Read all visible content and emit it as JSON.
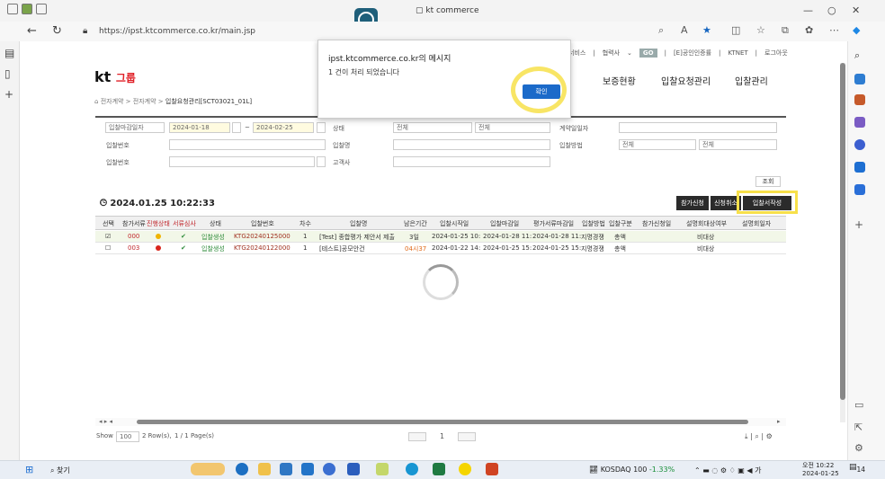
{
  "browser": {
    "tab_title": "kt commerce",
    "url": "https://ipst.ktcommerce.co.kr/main.jsp"
  },
  "page": {
    "top_menu": [
      "서비스",
      "협력사",
      "GO",
      "[E]공인인증률",
      "KTNET",
      "로그아웃"
    ],
    "logo_text": "kt",
    "logo_sub": "그룹",
    "main_nav": [
      "보증현황",
      "입찰요청관리",
      "입찰관리"
    ],
    "breadcrumb": [
      "전자계약",
      "전자계약"
    ],
    "breadcrumb_current": "입찰요청관리[SCT03021_01L]"
  },
  "form": {
    "date_type": "입찰마감일자",
    "date_from": "2024-01-18",
    "date_to": "2024-02-25",
    "status_label": "상태",
    "status_value": "전체",
    "status_value2": "전체",
    "contract_date_label": "계약일일자",
    "request_no_label": "입찰번호",
    "bid_name_label": "입찰명",
    "bid_method_label": "입찰방법",
    "bid_method_value": "전체",
    "bid_method_value2": "전체",
    "bid_no_label": "입찰번호",
    "notice_label": "고객사",
    "search_button": "조회"
  },
  "list": {
    "datetime": "2024.01.25  10:22:33",
    "buttons": [
      "참가신청",
      "신청취소",
      "입찰서작성"
    ],
    "columns": [
      "선택",
      "참가서류",
      "진행상태",
      "서류심사",
      "상태",
      "입찰번호",
      "차수",
      "입찰명",
      "남은기간",
      "입찰시작일",
      "입찰마감일",
      "평가서류마감일",
      "입찰방법",
      "입찰구분",
      "참가신청일",
      "설명회대상여부",
      "설명회일자"
    ],
    "rows": [
      {
        "sel": "☑",
        "doc": "000",
        "prog": "yellow",
        "review": "✔",
        "status": "입찰생성",
        "bid_no": "KTG20240125000",
        "round": "1",
        "name": "[Test] 종합평가 제안서 제출",
        "remain": "3일",
        "start": "2024-01-25 10:",
        "end": "2024-01-28 11:",
        "eval_end": "2024-01-28 11:",
        "method": "지명경쟁",
        "kind": "총액",
        "apply": "",
        "briefing": "비대상"
      },
      {
        "sel": "☐",
        "doc": "003",
        "prog": "red",
        "review": "✔",
        "status": "입찰생성",
        "bid_no": "KTG20240122000",
        "round": "1",
        "name": "[테스트]공모안건",
        "remain": "04시37",
        "start": "2024-01-22 14:",
        "end": "2024-01-25 15:",
        "eval_end": "2024-01-25 15:",
        "method": "지명경쟁",
        "kind": "총액",
        "apply": "",
        "briefing": "비대상"
      }
    ],
    "footer_show": "Show",
    "page_size": "100",
    "rows_info": "2 Row(s),",
    "pages_info": "1 / 1 Page(s)",
    "page_current": "1"
  },
  "dialog": {
    "title": "ipst.ktcommerce.co.kr의 메시지",
    "message": "1 건이 처리 되었습니다",
    "ok_label": "확인"
  },
  "taskbar": {
    "search_label": "찾기",
    "stock": "KOSDAQ 100",
    "stock_change": "-1.33%",
    "time": "오전 10:22",
    "date": "2024-01-25",
    "badge": "14"
  }
}
